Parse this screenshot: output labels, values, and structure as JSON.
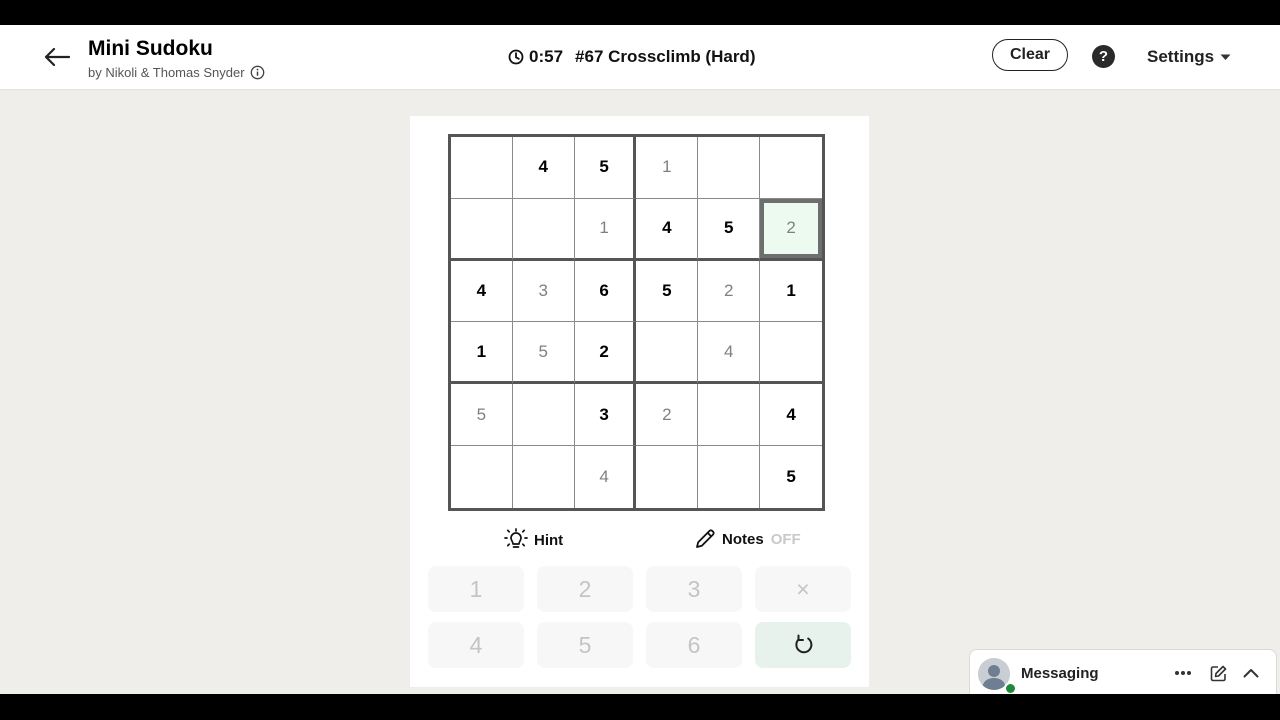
{
  "header": {
    "title": "Mini Sudoku",
    "byline": "by Nikoli & Thomas Snyder",
    "timer": "0:57",
    "puzzle_label": "#67 Crossclimb (Hard)",
    "clear_label": "Clear",
    "help_label": "?",
    "settings_label": "Settings"
  },
  "board": {
    "selected": [
      1,
      5
    ],
    "cells": [
      [
        {
          "v": "",
          "t": "e"
        },
        {
          "v": "4",
          "t": "g"
        },
        {
          "v": "5",
          "t": "g"
        },
        {
          "v": "1",
          "t": "u"
        },
        {
          "v": "",
          "t": "e"
        },
        {
          "v": "",
          "t": "e"
        }
      ],
      [
        {
          "v": "",
          "t": "e"
        },
        {
          "v": "",
          "t": "e"
        },
        {
          "v": "1",
          "t": "u"
        },
        {
          "v": "4",
          "t": "g"
        },
        {
          "v": "5",
          "t": "g"
        },
        {
          "v": "2",
          "t": "u"
        }
      ],
      [
        {
          "v": "4",
          "t": "g"
        },
        {
          "v": "3",
          "t": "u"
        },
        {
          "v": "6",
          "t": "g"
        },
        {
          "v": "5",
          "t": "g"
        },
        {
          "v": "2",
          "t": "u"
        },
        {
          "v": "1",
          "t": "g"
        }
      ],
      [
        {
          "v": "1",
          "t": "g"
        },
        {
          "v": "5",
          "t": "u"
        },
        {
          "v": "2",
          "t": "g"
        },
        {
          "v": "",
          "t": "e"
        },
        {
          "v": "4",
          "t": "u"
        },
        {
          "v": "",
          "t": "e"
        }
      ],
      [
        {
          "v": "5",
          "t": "u"
        },
        {
          "v": "",
          "t": "e"
        },
        {
          "v": "3",
          "t": "g"
        },
        {
          "v": "2",
          "t": "u"
        },
        {
          "v": "",
          "t": "e"
        },
        {
          "v": "4",
          "t": "g"
        }
      ],
      [
        {
          "v": "",
          "t": "e"
        },
        {
          "v": "",
          "t": "e"
        },
        {
          "v": "4",
          "t": "u"
        },
        {
          "v": "",
          "t": "e"
        },
        {
          "v": "",
          "t": "e"
        },
        {
          "v": "5",
          "t": "g"
        }
      ]
    ]
  },
  "tools": {
    "hint_label": "Hint",
    "notes_label": "Notes",
    "notes_state": "OFF"
  },
  "numpad": {
    "row1": [
      "1",
      "2",
      "3",
      "×"
    ],
    "row2": [
      "4",
      "5",
      "6"
    ]
  },
  "messaging": {
    "label": "Messaging"
  },
  "colors": {
    "accent_selected": "#ecfaef",
    "given_digit": "#000000",
    "entered_digit": "#808080",
    "presence": "#1c8a3b"
  }
}
